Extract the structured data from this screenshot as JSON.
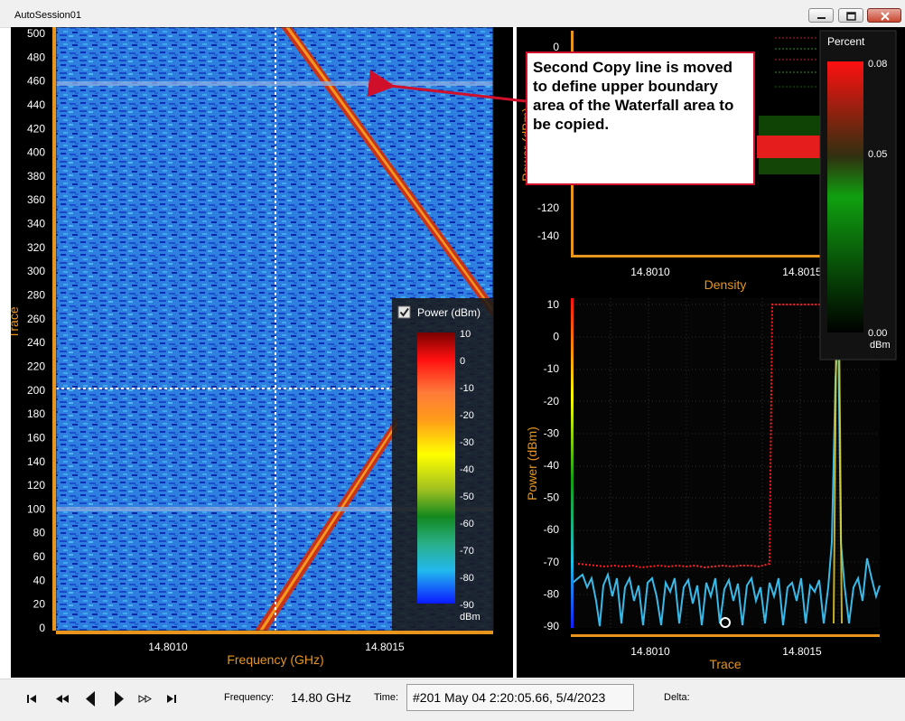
{
  "window": {
    "title": "AutoSession01"
  },
  "waterfall": {
    "y_axis_label": "Trace",
    "x_axis_label": "Frequency (GHz)",
    "y_ticks": [
      "500",
      "480",
      "460",
      "440",
      "420",
      "400",
      "380",
      "360",
      "340",
      "320",
      "300",
      "280",
      "260",
      "240",
      "220",
      "200",
      "180",
      "160",
      "140",
      "120",
      "100",
      "80",
      "60",
      "40",
      "20",
      "0"
    ],
    "x_ticks": [
      "14.8010",
      "14.8015"
    ],
    "legend": {
      "checkbox_checked": true,
      "title": "Power (dBm)",
      "ticks": [
        "10",
        "0",
        "-10",
        "-20",
        "-30",
        "-40",
        "-50",
        "-60",
        "-70",
        "-80",
        "-90"
      ],
      "unit": "dBm"
    }
  },
  "density_plot": {
    "y_axis_label": "Power (dBm)",
    "x_axis_label": "Density",
    "y_ticks": [
      "0",
      "-120",
      "-140"
    ],
    "x_ticks": [
      "14.8010",
      "14.8015"
    ]
  },
  "percent_legend": {
    "title": "Percent",
    "ticks": [
      "0.08",
      "0.05",
      "0.00"
    ],
    "unit": "dBm"
  },
  "trace_plot": {
    "y_axis_label": "Power (dBm)",
    "x_axis_label": "Trace",
    "y_ticks": [
      "10",
      "0",
      "-10",
      "-20",
      "-30",
      "-40",
      "-50",
      "-60",
      "-70",
      "-80",
      "-90"
    ],
    "x_ticks": [
      "14.8010",
      "14.8015"
    ]
  },
  "callout": {
    "text": "Second Copy line is moved to define upper boundary area of the Waterfall area to be copied."
  },
  "footer": {
    "frequency_label": "Frequency:",
    "frequency_value": "14.80 GHz",
    "time_label": "Time:",
    "time_value": "#201 May 04 2:20:05.66, 5/4/2023",
    "delta_label": "Delta:"
  },
  "colors": {
    "axis_orange": "#e8951e",
    "waterfall_blue": "#2a74d9",
    "trace_cyan": "#38b9e8",
    "max_hold_red": "#ff2020",
    "callout_border": "#d0102a"
  }
}
